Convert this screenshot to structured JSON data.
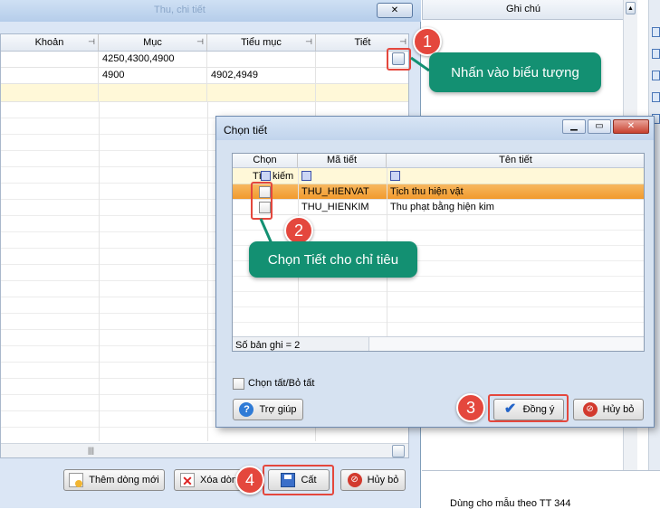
{
  "background_window": {
    "title": "Thu, chi tiết",
    "close_glyph": "✕",
    "columns": [
      {
        "label": "Khoản"
      },
      {
        "label": "Mục"
      },
      {
        "label": "Tiểu mục"
      },
      {
        "label": "Tiết"
      }
    ],
    "rows": [
      {
        "muc": "4250,4300,4900",
        "tieu_muc": ""
      },
      {
        "muc": "4900",
        "tieu_muc": "4902,4949"
      }
    ],
    "scroll_marker": "|||",
    "buttons": {
      "add_row": "Thêm dòng mới",
      "delete_row": "Xóa dòng",
      "save": "Cất",
      "cancel": "Hủy bỏ"
    }
  },
  "right_panel": {
    "header": "Ghi chú",
    "footer_text": "Dùng cho mẫu theo TT 344"
  },
  "dialog": {
    "title": "Chọn tiết",
    "columns": {
      "select": "Chọn",
      "code": "Mã tiết",
      "name": "Tên tiết"
    },
    "search_label": "Tìm kiếm",
    "rows": [
      {
        "code": "THU_HIENVAT",
        "name": "Tịch thu hiện vật",
        "selected_highlight": true
      },
      {
        "code": "THU_HIENKIM",
        "name": "Thu phạt bằng hiện kim",
        "selected_highlight": false
      }
    ],
    "record_count": "Số bản ghi = 2",
    "select_all_label": "Chọn tất/Bỏ tất",
    "buttons": {
      "help": "Trợ giúp",
      "ok": "Đồng ý",
      "cancel": "Hủy bỏ"
    }
  },
  "annotations": {
    "step1": {
      "number": "1",
      "text": "Nhấn vào biểu tượng"
    },
    "step2": {
      "number": "2",
      "text": "Chọn Tiết cho chỉ tiêu"
    },
    "step3": {
      "number": "3"
    },
    "step4": {
      "number": "4"
    }
  },
  "colors": {
    "title_bar": "#bcd3ee",
    "row_highlight": "#f5a84a",
    "callout": "#139072",
    "badge": "#e4473d",
    "search_row": "#fff8d8"
  }
}
